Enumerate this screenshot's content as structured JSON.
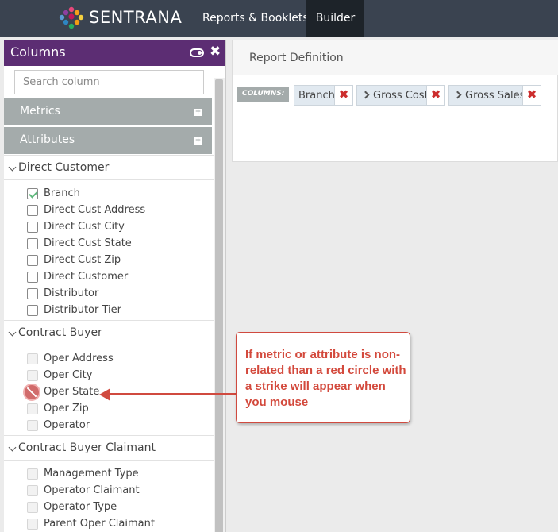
{
  "topbar": {
    "brand": "SENTRANA",
    "nav": [
      "Reports & Booklets",
      "Builder"
    ],
    "active_tab": "Builder",
    "colors": {
      "bar": "#3a4350",
      "active": "#1d2329"
    }
  },
  "columns_panel": {
    "title": "Columns",
    "icons": [
      "toggle-icon",
      "close-icon"
    ],
    "search_placeholder": "Search column",
    "accordions": [
      "Metrics",
      "Attributes"
    ],
    "groups": [
      {
        "label": "Direct Customer",
        "items": [
          {
            "label": "Branch",
            "state": "checked"
          },
          {
            "label": "Direct Cust Address",
            "state": "unchecked"
          },
          {
            "label": "Direct Cust City",
            "state": "unchecked"
          },
          {
            "label": "Direct Cust State",
            "state": "unchecked"
          },
          {
            "label": "Direct Cust Zip",
            "state": "unchecked"
          },
          {
            "label": "Direct Customer",
            "state": "unchecked"
          },
          {
            "label": "Distributor",
            "state": "unchecked"
          },
          {
            "label": "Distributor Tier",
            "state": "unchecked"
          }
        ]
      },
      {
        "label": "Contract Buyer",
        "items": [
          {
            "label": "Oper Address",
            "state": "disabled"
          },
          {
            "label": "Oper City",
            "state": "disabled"
          },
          {
            "label": "Oper State",
            "state": "not-allowed"
          },
          {
            "label": "Oper Zip",
            "state": "disabled"
          },
          {
            "label": "Operator",
            "state": "disabled"
          }
        ]
      },
      {
        "label": "Contract Buyer Claimant",
        "items": [
          {
            "label": "Management Type",
            "state": "disabled"
          },
          {
            "label": "Operator Claimant",
            "state": "disabled"
          },
          {
            "label": "Operator Type",
            "state": "disabled"
          },
          {
            "label": "Parent Oper Claimant",
            "state": "disabled"
          }
        ]
      }
    ],
    "colors": {
      "header": "#5c2d73",
      "accordion": "#a4abab",
      "check": "#5fb87c"
    }
  },
  "report_definition": {
    "title": "Report Definition",
    "columns_tag": "COLUMNS:",
    "columns": [
      {
        "label": "Branch",
        "expandable": false
      },
      {
        "label": "Gross Cost",
        "expandable": true
      },
      {
        "label": "Gross Sales",
        "expandable": true
      }
    ]
  },
  "annotation": {
    "text": "If metric or attribute is non-related than a red circle with a strike will appear when you mouse",
    "color": "#d3493c"
  }
}
